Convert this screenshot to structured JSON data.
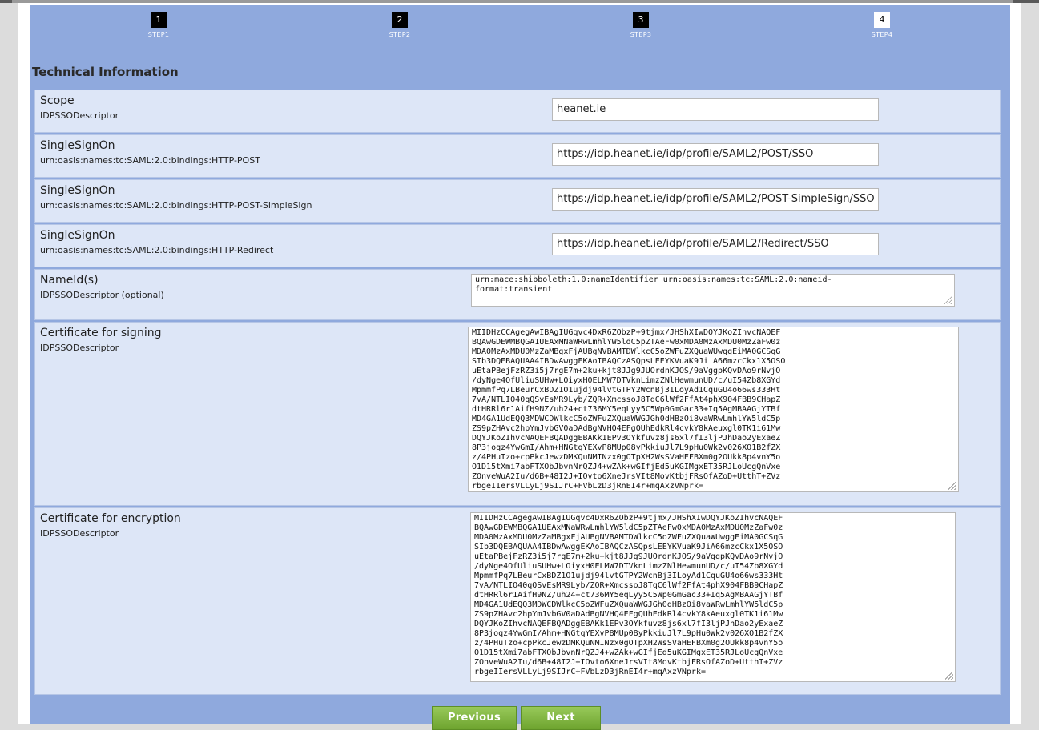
{
  "steps": [
    {
      "num": "1",
      "label": "STEP1"
    },
    {
      "num": "2",
      "label": "STEP2"
    },
    {
      "num": "3",
      "label": "STEP3"
    },
    {
      "num": "4",
      "label": "STEP4"
    }
  ],
  "section_title": "Technical Information",
  "rows": [
    {
      "title": "Scope",
      "subtitle": "IDPSSODescriptor",
      "value": "heanet.ie"
    },
    {
      "title": "SingleSignOn",
      "subtitle": "urn:oasis:names:tc:SAML:2.0:bindings:HTTP-POST",
      "value": "https://idp.heanet.ie/idp/profile/SAML2/POST/SSO"
    },
    {
      "title": "SingleSignOn",
      "subtitle": "urn:oasis:names:tc:SAML:2.0:bindings:HTTP-POST-SimpleSign",
      "value": "https://idp.heanet.ie/idp/profile/SAML2/POST-SimpleSign/SSO"
    },
    {
      "title": "SingleSignOn",
      "subtitle": "urn:oasis:names:tc:SAML:2.0:bindings:HTTP-Redirect",
      "value": "https://idp.heanet.ie/idp/profile/SAML2/Redirect/SSO"
    },
    {
      "title": "NameId(s)",
      "subtitle": "IDPSSODescriptor (optional)",
      "value": "urn:mace:shibboleth:1.0:nameIdentifier urn:oasis:names:tc:SAML:2.0:nameid-\nformat:transient"
    },
    {
      "title": "Certificate for signing",
      "subtitle": "IDPSSODescriptor",
      "value": "MIIDHzCCAgegAwIBAgIUGqvc4DxR6ZObzP+9tjmx/JHShXIwDQYJKoZIhvcNAQEF\nBQAwGDEWMBQGA1UEAxMNaWRwLmhlYW5ldC5pZTAeFw0xMDA0MzAxMDU0MzZaFw0z\nMDA0MzAxMDU0MzZaMBgxFjAUBgNVBAMTDWlkcC5oZWFuZXQuaWUwggEiMA0GCSqG\nSIb3DQEBAQUAA4IBDwAwggEKAoIBAQCzASQpsLEEYKVuaK9Ji A66mzcCkx1X5OSO\nuEtaPBejFzRZ3i5j7rgE7m+2ku+kjt8JJg9JUOrdnKJOS/9aVggpKQvDAo9rNvjO\n/dyNge4OfUliuSUHw+LOiyxH0ELMW7DTVknLimzZNlHewmunUD/c/uI54Zb8XGYd\nMpmmfPq7LBeurCxBDZ1O1ujdj94lvtGTPY2WcnBj3ILoyAd1CquGU4o66ws333Ht\n7vA/NTLIO40qQSvEsMR9Lyb/ZQR+XmcssoJ8TqC6lWf2FfAt4phX904FBB9CHapZ\ndtHRRl6r1AifH9NZ/uh24+ct736MY5eqLyy5C5Wp0GmGac33+Iq5AgMBAAGjYTBf\nMD4GA1UdEQQ3MDWCDWlkcC5oZWFuZXQuaWWGJGh0dHBzOi8vaWRwLmhlYW5ldC5p\nZS9pZHAvc2hpYmJvbGV0aDAdBgNVHQ4EFgQUhEdkRl4cvkY8kAeuxgl0TK1i61Mw\nDQYJKoZIhvcNAQEFBQADggEBAKk1EPv3OYkfuvz8js6xl7fI3ljPJhDao2yExaeZ\n8P3joqz4YwGmI/Ahm+HNGtqYEXvP8MUp08yPkkiuJl7L9pHu0Wk2v026XO1B2fZX\nz/4PHuTzo+cpPkcJewzDMKQuNMINzx0gOTpXH2WsSVaHEFBXm0g2OUkk8p4vnY5o\nO1D15tXmi7abFTXObJbvnNrQZJ4+wZAk+wGIfjEd5uKGIMgxET35RJLoUcgQnVxe\nZOnveWuA2Iu/d6B+48I2J+IOvto6XneJrsVIt8MovKtbjFRsOfAZoD+UtthT+ZVz\nrbgeIIersVLLyLj9SIJrC+FVbLzD3jRnEI4r+mqAxzVNprk="
    },
    {
      "title": "Certificate for encryption",
      "subtitle": "IDPSSODescriptor",
      "value": "MIIDHzCCAgegAwIBAgIUGqvc4DxR6ZObzP+9tjmx/JHShXIwDQYJKoZIhvcNAQEF\nBQAwGDEWMBQGA1UEAxMNaWRwLmhlYW5ldC5pZTAeFw0xMDA0MzAxMDU0MzZaFw0z\nMDA0MzAxMDU0MzZaMBgxFjAUBgNVBAMTDWlkcC5oZWFuZXQuaWUwggEiMA0GCSqG\nSIb3DQEBAQUAA4IBDwAwggEKAoIBAQCzASQpsLEEYKVuaK9JiA66mzcCkx1X5OSO\nuEtaPBejFzRZ3i5j7rgE7m+2ku+kjt8JJg9JUOrdnKJOS/9aVggpKQvDAo9rNvjO\n/dyNge4OfUliuSUHw+LOiyxH0ELMW7DTVknLimzZNlHewmunUD/c/uI54Zb8XGYd\nMpmmfPq7LBeurCxBDZ1O1ujdj94lvtGTPY2WcnBj3ILoyAd1CquGU4o66ws333Ht\n7vA/NTLIO40qQSvEsMR9Lyb/ZQR+XmcssoJ8TqC6lWf2FfAt4phX904FBB9CHapZ\ndtHRRl6r1AifH9NZ/uh24+ct736MY5eqLyy5C5Wp0GmGac33+Iq5AgMBAAGjYTBf\nMD4GA1UdEQQ3MDWCDWlkcC5oZWFuZXQuaWWGJGh0dHBzOi8vaWRwLmhlYW5ldC5p\nZS9pZHAvc2hpYmJvbGV0aDAdBgNVHQ4EFgQUhEdkRl4cvkY8kAeuxgl0TK1i61Mw\nDQYJKoZIhvcNAQEFBQADggEBAKk1EPv3OYkfuvz8js6xl7fI3ljPJhDao2yExaeZ\n8P3joqz4YwGmI/Ahm+HNGtqYEXvP8MUp08yPkkiuJl7L9pHu0Wk2v026XO1B2fZX\nz/4PHuTzo+cpPkcJewzDMKQuNMINzx0gOTpXH2WsSVaHEFBXm0g2OUkk8p4vnY5o\nO1D15tXmi7abFTXObJbvnNrQZJ4+wZAk+wGIfjEd5uKGIMgxET35RJLoUcgQnVxe\nZOnveWuA2Iu/d6B+48I2J+IOvto6XneJrsVIt8MovKtbjFRsOfAZoD+UtthT+ZVz\nrbgeIIersVLLyLj9SIJrC+FVbLzD3jRnEI4r+mqAxzVNprk="
    }
  ],
  "buttons": {
    "previous": "Previous",
    "next": "Next"
  }
}
